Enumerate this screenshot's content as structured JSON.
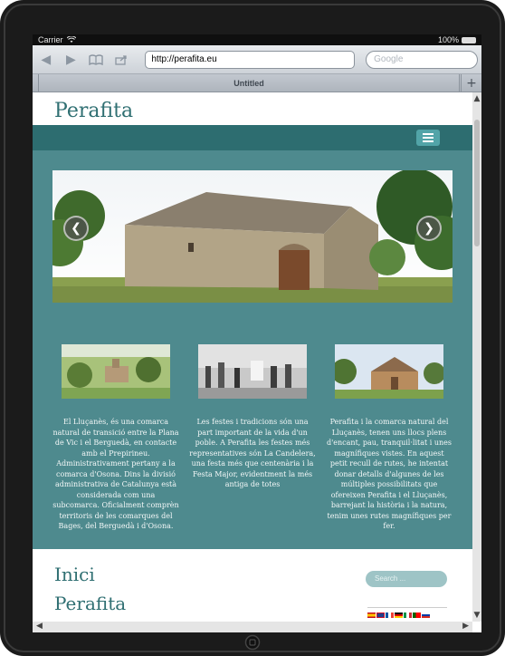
{
  "status": {
    "carrier": "Carrier",
    "battery": "100%"
  },
  "browser": {
    "url": "http://perafita.eu",
    "search_placeholder": "Google",
    "tab_title": "Untitled",
    "new_tab": "+"
  },
  "site": {
    "title": "Perafita",
    "columns": [
      {
        "text": "El Lluçanès, és una comarca natural de transició entre la Plana de Vic i el Berguedà, en contacte amb el Prepirineu. Administrativament pertany a la comarca d'Osona. Dins la divisió administrativa de Catalunya està considerada com una subcomarca. Oficialment comprèn territoris de les comarques del Bages, del Berguedà i d'Osona."
      },
      {
        "text": "Les festes i tradicions són una part important de la vida d'un poble. A Perafita les festes més representatives són La Candelera, una festa més que centenària i la Festa Major, evidentment la més antiga de totes"
      },
      {
        "text": "Perafita i la comarca natural del Lluçanès, tenen uns llocs plens d'encant, pau, tranquil·litat i unes magnífiques vistes. En aquest petit recull de rutes, he intentat donar detalls d'algunes de les múltiples possibilitats que ofereixen Perafita i el Lluçanès, barrejant la història i la natura, tenim unes rutes magnífiques per fer."
      }
    ],
    "headings": [
      "Inici",
      "Perafita"
    ],
    "search_placeholder": "Search ..."
  },
  "colors": {
    "teal_dark": "#2d6d70",
    "teal": "#4e8a8e",
    "title": "#2f6f72"
  }
}
